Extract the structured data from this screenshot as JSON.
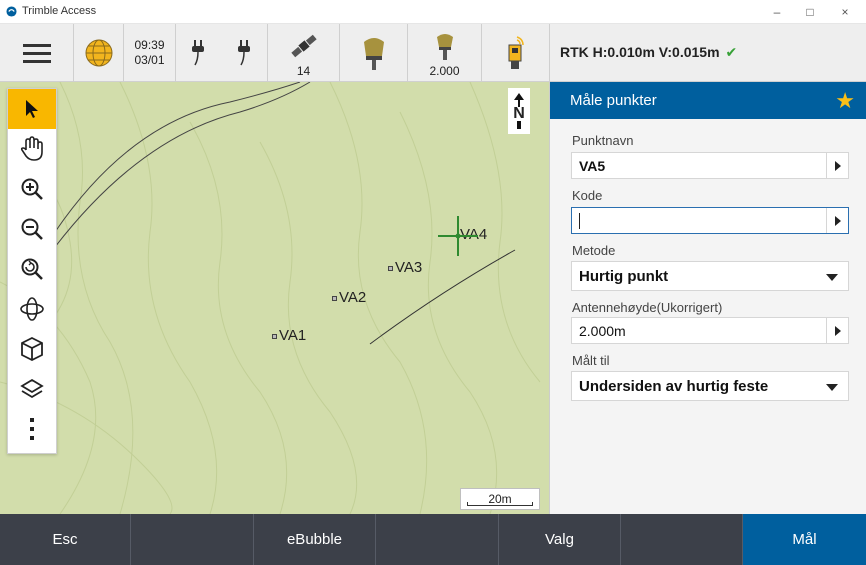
{
  "window": {
    "title": "Trimble Access",
    "minimize_glyph": "–",
    "maximize_glyph": "□",
    "close_glyph": "×"
  },
  "toolbar": {
    "menu_icon": "hamburger-icon",
    "time": "09:39",
    "date": "03/01",
    "satellite_count": "14",
    "antenna_height": "2.000",
    "rtk_status": "RTK H:0.010m V:0.015m",
    "rtk_ok_glyph": "✔"
  },
  "map": {
    "north_label": "N",
    "scale_label": "20m",
    "points": [
      {
        "name": "VA1"
      },
      {
        "name": "VA2"
      },
      {
        "name": "VA3"
      },
      {
        "name": "VA4"
      }
    ],
    "tools": [
      "select-arrow-icon",
      "pan-hand-icon",
      "zoom-in-icon",
      "zoom-out-icon",
      "zoom-extents-icon",
      "orbit-icon",
      "3d-cube-icon",
      "layers-icon",
      "more-vertical-icon"
    ],
    "active_tool": "select-arrow-icon",
    "map_color": "#d2ddab"
  },
  "panel": {
    "title": "Måle punkter",
    "favorite_glyph": "★",
    "point_name_label": "Punktnavn",
    "point_name_value": "VA5",
    "code_label": "Kode",
    "code_value": "",
    "method_label": "Metode",
    "method_value": "Hurtig punkt",
    "antenna_label": "Antennehøyde(Ukorrigert)",
    "antenna_value": "2.000m",
    "measured_to_label": "Målt til",
    "measured_to_value": "Undersiden av hurtig feste",
    "header_color": "#005f9e",
    "star_color": "#fbbf16"
  },
  "softkeys": {
    "esc": "Esc",
    "ebubble": "eBubble",
    "options": "Valg",
    "measure": "Mål"
  }
}
